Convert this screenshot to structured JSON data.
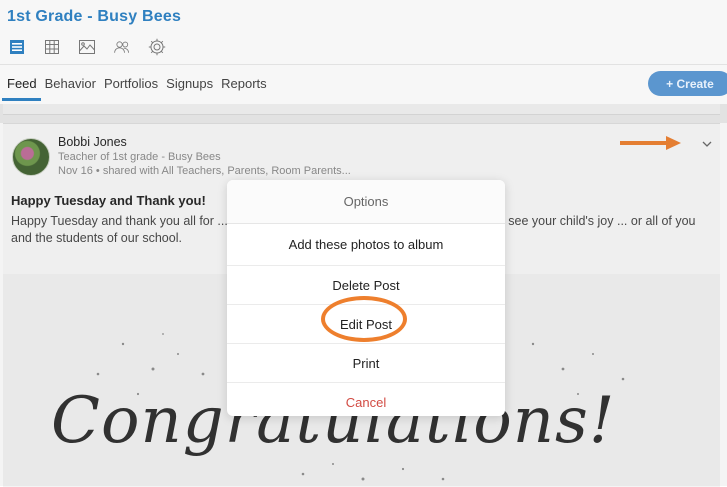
{
  "header": {
    "class_title": "1st Grade - Busy Bees",
    "icons": [
      "newsfeed-icon",
      "calendar-grid-icon",
      "photo-icon",
      "people-icon",
      "settings-gear-icon"
    ],
    "accent_color": "#2f80c0"
  },
  "tabs": [
    {
      "label": "Feed",
      "active": true
    },
    {
      "label": "Behavior",
      "active": false
    },
    {
      "label": "Portfolios",
      "active": false
    },
    {
      "label": "Signups",
      "active": false
    },
    {
      "label": "Reports",
      "active": false
    }
  ],
  "create_button": {
    "label": "+ Create",
    "color": "#5b96cf"
  },
  "post": {
    "author": "Bobbi Jones",
    "role": "Teacher of 1st grade - Busy Bees",
    "shared": "Nov 16 • shared with All Teachers, Parents, Room Parents...",
    "title": "Happy Tuesday and Thank you!",
    "body": "Happy Tuesday and thank you all for ... ed today by the PTA. I hope that you were able to see your child's joy ... or all of you and the students of our school.",
    "image_text": "Congratulations!"
  },
  "options_modal": {
    "title": "Options",
    "items": [
      "Add these photos to album",
      "Delete Post",
      "Edit Post",
      "Print"
    ],
    "cancel": "Cancel",
    "cancel_color": "#d24b43",
    "highlight_color": "#ee7f2d"
  }
}
